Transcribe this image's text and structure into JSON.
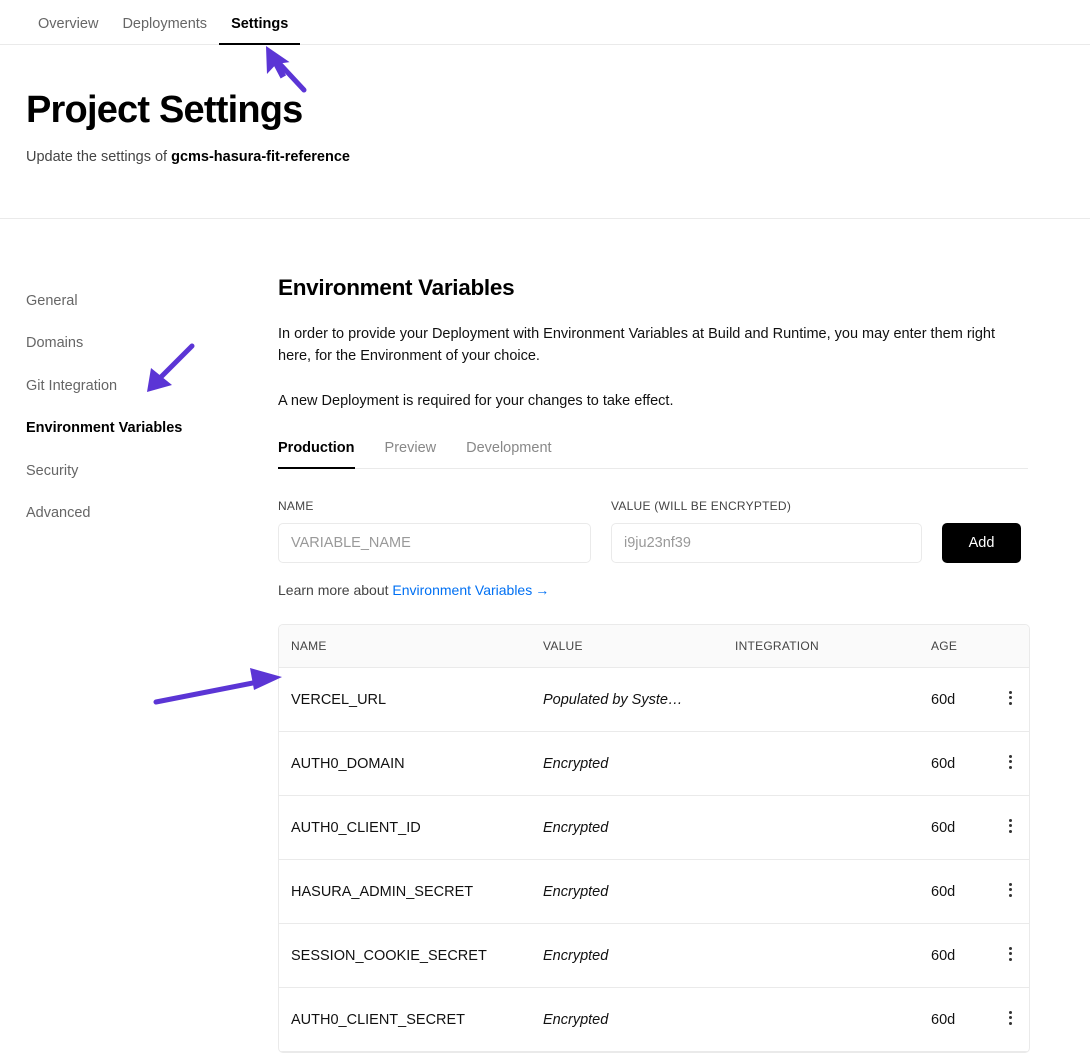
{
  "topnav": {
    "tabs": [
      {
        "label": "Overview",
        "active": false
      },
      {
        "label": "Deployments",
        "active": false
      },
      {
        "label": "Settings",
        "active": true
      }
    ]
  },
  "header": {
    "title": "Project Settings",
    "subtitle_prefix": "Update the settings of ",
    "project_name": "gcms-hasura-fit-reference"
  },
  "sidebar": {
    "items": [
      {
        "label": "General",
        "active": false
      },
      {
        "label": "Domains",
        "active": false
      },
      {
        "label": "Git Integration",
        "active": false
      },
      {
        "label": "Environment Variables",
        "active": true
      },
      {
        "label": "Security",
        "active": false
      },
      {
        "label": "Advanced",
        "active": false
      }
    ]
  },
  "main": {
    "section_title": "Environment Variables",
    "paragraph_1": "In order to provide your Deployment with Environment Variables at Build and Runtime, you may enter them right here, for the Environment of your choice.",
    "paragraph_2": "A new Deployment is required for your changes to take effect.",
    "env_tabs": [
      {
        "label": "Production",
        "active": true
      },
      {
        "label": "Preview",
        "active": false
      },
      {
        "label": "Development",
        "active": false
      }
    ],
    "form": {
      "name_label": "NAME",
      "name_placeholder": "VARIABLE_NAME",
      "name_value": "",
      "value_label": "VALUE (WILL BE ENCRYPTED)",
      "value_placeholder": "i9ju23nf39",
      "value_value": "",
      "add_label": "Add"
    },
    "learn_more": {
      "prefix": "Learn more about ",
      "link_text": "Environment Variables",
      "arrow": "→"
    },
    "table": {
      "columns": [
        "NAME",
        "VALUE",
        "INTEGRATION",
        "AGE"
      ],
      "rows": [
        {
          "name": "VERCEL_URL",
          "value": "Populated by Syste…",
          "integration": "",
          "age": "60d"
        },
        {
          "name": "AUTH0_DOMAIN",
          "value": "Encrypted",
          "integration": "",
          "age": "60d"
        },
        {
          "name": "AUTH0_CLIENT_ID",
          "value": "Encrypted",
          "integration": "",
          "age": "60d"
        },
        {
          "name": "HASURA_ADMIN_SECRET",
          "value": "Encrypted",
          "integration": "",
          "age": "60d"
        },
        {
          "name": "SESSION_COOKIE_SECRET",
          "value": "Encrypted",
          "integration": "",
          "age": "60d"
        },
        {
          "name": "AUTH0_CLIENT_SECRET",
          "value": "Encrypted",
          "integration": "",
          "age": "60d"
        }
      ]
    }
  },
  "annotations": {
    "accent_color": "#5B35D5",
    "markers": [
      {
        "name": "cursor-pointing-at-settings-tab"
      },
      {
        "name": "arrow-pointing-at-environment-variables"
      },
      {
        "name": "arrow-pointing-at-vercel-url-row"
      }
    ]
  }
}
